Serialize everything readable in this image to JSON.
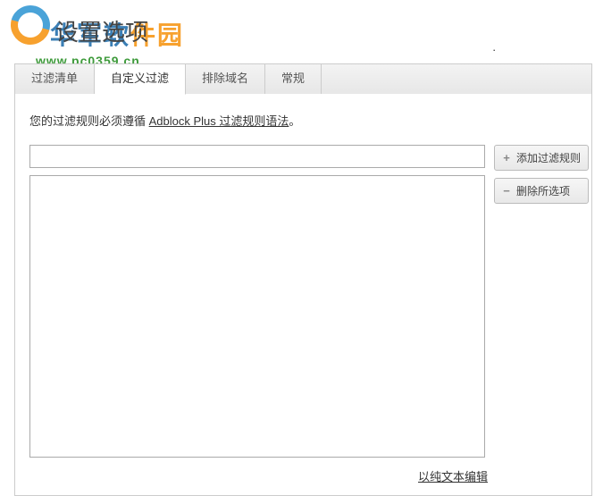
{
  "watermark": {
    "brand_part1": "华军软",
    "brand_part2": "件园",
    "url": "www.pc0359.cn"
  },
  "page_title": "设置选项",
  "top_period": ".",
  "tabs": [
    {
      "label": "过滤清单",
      "active": false
    },
    {
      "label": "自定义过滤",
      "active": true
    },
    {
      "label": "排除域名",
      "active": false
    },
    {
      "label": "常规",
      "active": false
    }
  ],
  "panel": {
    "desc_prefix": "您的过滤规则必须遵循 ",
    "desc_link": "Adblock Plus 过滤规则语法",
    "desc_suffix": "。",
    "filter_input_value": "",
    "filter_input_placeholder": "",
    "filter_list_content": "",
    "add_button_label": "添加过滤规则",
    "remove_button_label": "删除所选项",
    "edit_plain_text_label": "以纯文本编辑"
  }
}
